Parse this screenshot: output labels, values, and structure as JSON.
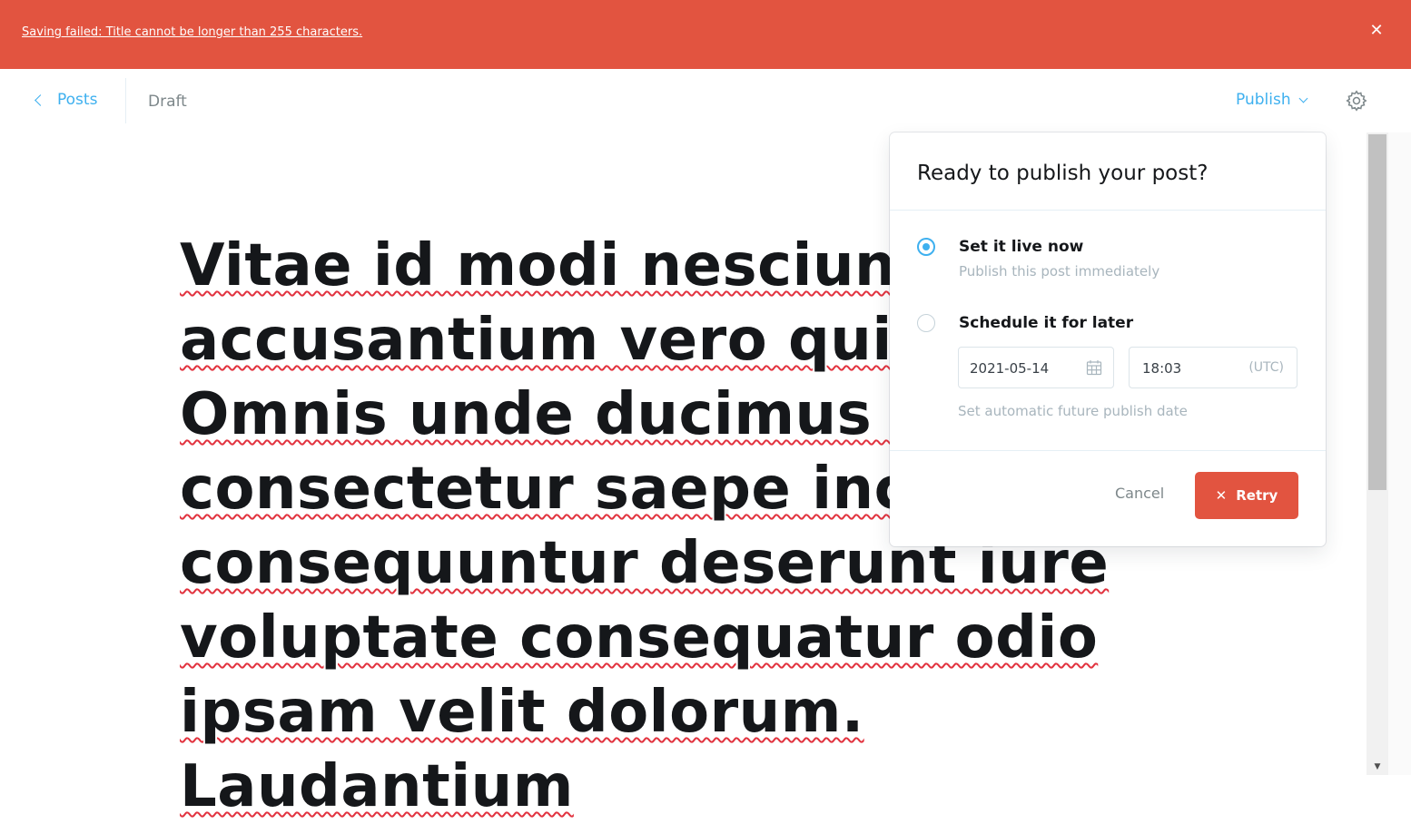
{
  "banner": {
    "message": "Saving failed: Title cannot be longer than 255 characters.",
    "close_icon": "close-icon",
    "color": "#e25440"
  },
  "header": {
    "back_label": "Posts",
    "status": "Draft",
    "publish_label": "Publish",
    "settings_icon": "gear-icon"
  },
  "editor": {
    "title_text": "Vitae id modi nesciunt accusantium vero qui eius. Omnis unde ducimus eos consectetur saepe incidunt consequuntur deserunt iure voluptate consequatur odio ipsam velit dolorum. Laudantium"
  },
  "publish_menu": {
    "heading": "Ready to publish your post?",
    "options": [
      {
        "label": "Set it live now",
        "description": "Publish this post immediately",
        "selected": true
      },
      {
        "label": "Schedule it for later",
        "description": "Set automatic future publish date",
        "selected": false
      }
    ],
    "date_value": "2021-05-14",
    "time_value": "18:03",
    "timezone": "(UTC)",
    "cancel_label": "Cancel",
    "retry_label": "Retry"
  },
  "colors": {
    "accent": "#3eb0ef",
    "error": "#e25440",
    "text": "#15171a",
    "muted": "#a8b5bd"
  }
}
